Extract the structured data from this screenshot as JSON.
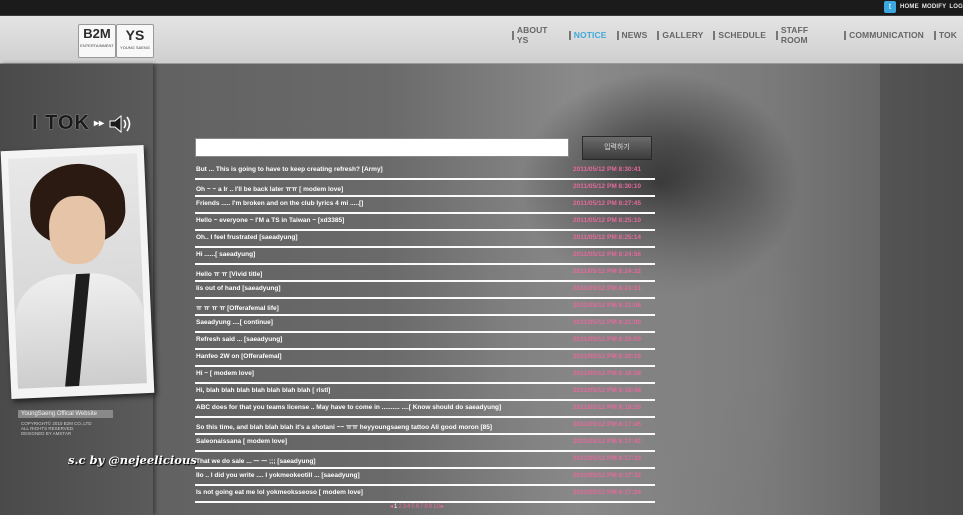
{
  "topbar": {
    "links": [
      "HOME",
      "MODIFY",
      "LOGOUT"
    ]
  },
  "header": {
    "logo_b2m": "B2M",
    "logo_b2m_sub": "ENTERTAINMENT",
    "logo_ys": "YS",
    "logo_ys_sub": "YOUNG SAENG",
    "nav": [
      "ABOUT YS",
      "NOTICE",
      "NEWS",
      "GALLERY",
      "SCHEDULE",
      "STAFF ROOM",
      "COMMUNICATION",
      "TOK"
    ],
    "active_nav": "NOTICE",
    "active_color": "#3fa9dc"
  },
  "left_panel": {
    "title": "I TOK",
    "title_arrows": "▸▸",
    "official": "YoungSaeng Offical Website",
    "copyright_lines": [
      "COPYRIGHT© 2010 B2M CO.,LTD",
      "ALL RIGHTS RESERVED.",
      "DESIGNED BY AMSTAR"
    ],
    "signature": "s.c by @nejeelicious"
  },
  "form": {
    "input_value": "",
    "submit_label": "입력하기"
  },
  "messages": [
    {
      "text": "But ... This is going to have to keep creating refresh? [Army]",
      "time": "2011/05/12 PM 8:30:41"
    },
    {
      "text": "Oh ~ ~ a lr .. I'll be back later ㅠㅠ [ modem love]",
      "time": "2011/05/12 PM 8:30:10"
    },
    {
      "text": "Friends ..... I'm broken and on the club lyrics 4 mi .....[]",
      "time": "2011/05/12 PM 8:27:45"
    },
    {
      "text": "Hello ~ everyone ~ I'M a TS in Taiwan ~ [xd3385]",
      "time": "2011/05/12 PM 8:25:10"
    },
    {
      "text": "Oh.. I feel frustrated [saeadyung]",
      "time": "2011/05/12 PM 8:25:14"
    },
    {
      "text": "Hi ......[ saeadyung]",
      "time": "2011/05/12 PM 8:24:56"
    },
    {
      "text": " Hello ㅠ ㅠ [Vivid title]",
      "time": "2011/05/12 PM 8:24:32"
    },
    {
      "text": "Iis out of hand [saeadyung]",
      "time": "2011/05/12 PM 8:24:31"
    },
    {
      "text": "ㅠ ㅠ ㅠ ㅠ [Offerafemal life]",
      "time": "2011/05/12 PM 8:21:06"
    },
    {
      "text": "Saeadyung ....[ continue]",
      "time": "2011/05/12 PM 8:21:00"
    },
    {
      "text": "Refresh said ... [saeadyung]",
      "time": "2011/05/12 PM 8:20:50"
    },
    {
      "text": "Hanfeo 2W on [Offerafemal]",
      "time": "2011/05/12 PM 8:20:18"
    },
    {
      "text": "Hi ~ [ modem love]",
      "time": "2011/05/12 PM 8:18:58"
    },
    {
      "text": "Hi, blah blah blah blah blah blah blah [ rlstl]",
      "time": "2011/05/12 PM 8:18:48"
    },
    {
      "text": "ABC does for that you teams license .. May have to come in .......... ....[ Know should do saeadyung]",
      "time": "2011/05/12 PM 8:18:35"
    },
    {
      "text": "So this time, and blah blah blah it's a shotani ~~ ㅠㅠ heyyoungsaeng tattoo All good moron [85]",
      "time": "2011/05/12 PM 8:17:45"
    },
    {
      "text": "Saleonaissana [ modem love]",
      "time": "2011/05/12 PM 8:17:42"
    },
    {
      "text": "That we do sale ... ㅡ ㅡ ;;; [saeadyung]",
      "time": "2011/05/12 PM 8:17:33"
    },
    {
      "text": "IIo .. I did you write .... I yokmeokeotill ... [saeadyung]",
      "time": "2011/05/12 PM 8:17:32"
    },
    {
      "text": "Is not going eat me lol yokmeoksseoso [ modem love]",
      "time": "2011/05/12 PM 8:17:24"
    }
  ],
  "pagination": {
    "prev": "◂",
    "next": "▸",
    "pages": [
      "1",
      "2",
      "3",
      "4",
      "5",
      "6",
      "7",
      "8",
      "9",
      "10"
    ],
    "current": "1"
  },
  "colors": {
    "timestamp": "#e46a9a",
    "active_nav": "#3fa9dc"
  }
}
